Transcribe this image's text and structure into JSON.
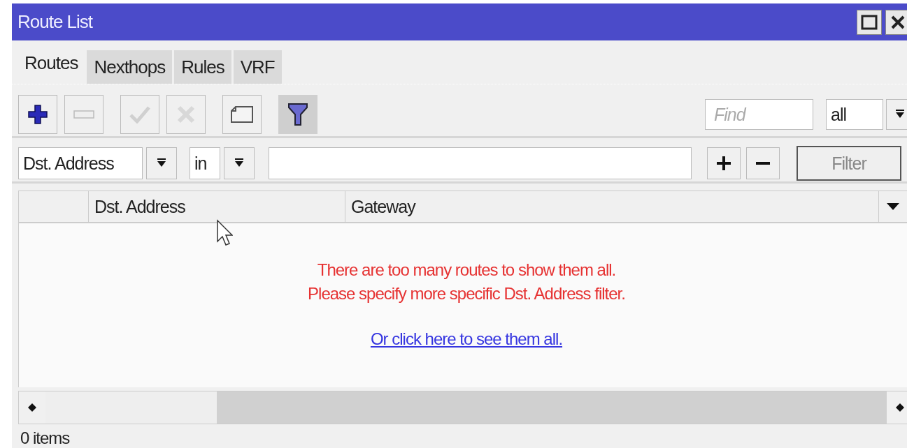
{
  "window": {
    "title": "Route List"
  },
  "tabs": [
    {
      "label": "Routes",
      "selected": true
    },
    {
      "label": "Nexthops",
      "selected": false
    },
    {
      "label": "Rules",
      "selected": false
    },
    {
      "label": "VRF",
      "selected": false
    }
  ],
  "toolbar": {
    "buttons": [
      {
        "kind": "add",
        "disabled": false,
        "pressed": false
      },
      {
        "kind": "remove",
        "disabled": true,
        "pressed": false
      },
      {
        "kind": "enable",
        "disabled": true,
        "pressed": false
      },
      {
        "kind": "disable",
        "disabled": true,
        "pressed": false
      },
      {
        "kind": "comment",
        "disabled": false,
        "pressed": false
      },
      {
        "kind": "filter",
        "disabled": false,
        "pressed": true
      }
    ],
    "find": {
      "placeholder": "Find"
    },
    "scope": {
      "value": "all"
    }
  },
  "filter": {
    "property": "Dst. Address",
    "operator": "in",
    "button": "Filter"
  },
  "table": {
    "columns": [
      {
        "label": "Dst. Address"
      },
      {
        "label": "Gateway"
      }
    ],
    "message": [
      "There are too many routes to show them all.",
      "Please specify more specific Dst. Address filter."
    ],
    "link": "Or click here to see them all."
  },
  "status_bar": {
    "text": "0 items"
  }
}
